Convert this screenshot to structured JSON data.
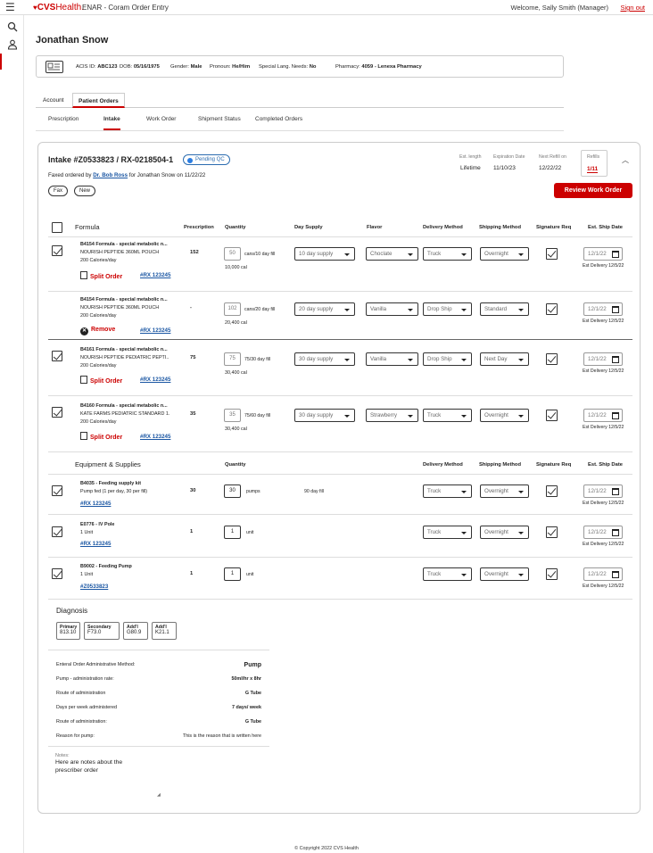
{
  "header": {
    "brand_bold": "CVS",
    "brand_light": "Health.",
    "app_title": "ENAR - Coram Order Entry",
    "welcome": "Welcome, Sally Smith (Manager)",
    "signout": "Sign out"
  },
  "patient": {
    "name": "Jonathan Snow",
    "acis_label": "ACIS ID:",
    "acis": "ABC123",
    "dob_label": "DOB:",
    "dob": "05/16/1975",
    "gender_label": "Gender:",
    "gender": "Male",
    "pronoun_label": "Pronoun:",
    "pronoun": "He/Him",
    "lang_label": "Special Lang. Needs:",
    "lang": "No",
    "pharm_label": "Pharmacy:",
    "pharm": "4059 - Lenexa Pharmacy"
  },
  "tabs": [
    "Account",
    "Patient Orders"
  ],
  "subtabs": [
    "Prescription",
    "Intake",
    "Work Order",
    "Shipment Status",
    "Completed Orders"
  ],
  "intake": {
    "title": "Intake #Z0533823 / RX-0218504-1",
    "status": "Pending QC",
    "faxed_pre": "Faxed ordered by ",
    "faxed_doc": "Dr. Bob Ross",
    "faxed_post": " for Jonathan Snow on 11/22/22",
    "pills": [
      "Fax",
      "New"
    ],
    "meta_labels": [
      "Est. length",
      "Expiration Date",
      "Next Refill on"
    ],
    "meta_values": [
      "Lifetime",
      "11/10/23",
      "12/22/22"
    ],
    "refills_label": "Refills",
    "refills": "1/11",
    "review_btn": "Review Work Order"
  },
  "formula_headers": {
    "formula": "Formula",
    "prescription": "Prescription",
    "quantity": "Quantity",
    "day_supply": "Day Supply",
    "flavor": "Flavor",
    "delivery": "Delivery Method",
    "shipping": "Shipping Method",
    "sig": "Signature Req",
    "ship": "Est. Ship Date"
  },
  "formulas": [
    {
      "name": "B4154 Formula - special metabolic n...",
      "sub1": "NOURISH PEPTIDE 360ML POUCH",
      "sub2": "200 Calories/day",
      "action": "Split Order",
      "rx": "#RX 123245",
      "presc": "152",
      "qty": "50",
      "unit": "cans/10 day fill",
      "cal": "10,000 cal",
      "supply": "10 day supply",
      "flavor": "Choclate",
      "delivery": "Truck",
      "shipping": "Overnight",
      "date": "12/1/22",
      "est": "Est Delivery 12/5/22"
    },
    {
      "name": "B4154 Formula - special metabolic n...",
      "sub1": "NOURISH PEPTIDE 360ML POUCH",
      "sub2": "200 Calories/day",
      "action": "Remove",
      "rx": "#RX 123245",
      "presc": "-",
      "qty": "102",
      "unit": "cans/20 day fill",
      "cal": "20,400 cal",
      "supply": "20 day supply",
      "flavor": "Vanilla",
      "delivery": "Drop Ship",
      "shipping": "Standard",
      "date": "12/1/22",
      "est": "Est Delivery 12/5/22"
    },
    {
      "name": "B4161 Formula - special metabolic n...",
      "sub1": "NOURISH PEPTIDE PEDIATRIC PEPTI..",
      "sub2": "200 Calories/day",
      "action": "Split Order",
      "rx": "#RX 123245",
      "presc": "75",
      "qty": "75",
      "unit": "75/30 day fill",
      "cal": "30,400 cal",
      "supply": "30 day supply",
      "flavor": "Vanilla",
      "delivery": "Drop Ship",
      "shipping": "Next Day",
      "date": "12/1/22",
      "est": "Est Delivery 12/5/22"
    },
    {
      "name": "B4160 Formula - special metabolic n...",
      "sub1": "KATE FARMS PEDIATRIC STANDARD 1.",
      "sub2": "200 Calories/day",
      "action": "Split Order",
      "rx": "#RX 123245",
      "presc": "35",
      "qty": "35",
      "unit": "75/60 day fill",
      "cal": "30,400 cal",
      "supply": "30 day supply",
      "flavor": "Strawberry",
      "delivery": "Truck",
      "shipping": "Overnight",
      "date": "12/1/22",
      "est": "Est Delivery 12/5/22"
    }
  ],
  "equip_headers": {
    "title": "Equipment & Supplies",
    "quantity": "Quantity",
    "delivery": "Delivery Method",
    "shipping": "Shipping Method",
    "sig": "Signature Req",
    "ship": "Est. Ship Date"
  },
  "equipment": [
    {
      "name": "B4035 - Feeding supply kit",
      "sub": "Pump fed (1 per day, 30 per fill)",
      "rx": "#RX 123245",
      "presc": "30",
      "qty": "30",
      "unit": "pumps",
      "fill": "90 day fill",
      "delivery": "Truck",
      "shipping": "Overnight",
      "date": "12/1/22",
      "est": "Est Delivery 12/5/22"
    },
    {
      "name": "E0776 - IV Pole",
      "sub": "1 Unit",
      "rx": "#RX 123245",
      "presc": "1",
      "qty": "1",
      "unit": "unit",
      "fill": "",
      "delivery": "Truck",
      "shipping": "Overnight",
      "date": "12/1/22",
      "est": "Est Delivery 12/5/22"
    },
    {
      "name": "B9002 - Feeding Pump",
      "sub": "1 Unit",
      "rx": "#Z0533823",
      "presc": "1",
      "qty": "1",
      "unit": "unit",
      "fill": "",
      "delivery": "Truck",
      "shipping": "Overnight",
      "date": "12/1/22",
      "est": "Est Delivery 12/5/22"
    }
  ],
  "diagnosis": {
    "title": "Diagnosis",
    "codes": [
      {
        "label": "Primary",
        "code": "813.10"
      },
      {
        "label": "Secondary",
        "code": "F73.0"
      },
      {
        "label": "Add'l",
        "code": "G80.9"
      },
      {
        "label": "Add'l",
        "code": "K21.1"
      }
    ]
  },
  "admin": [
    {
      "label": "Enteral Order Administrative Method:",
      "value": "Pump"
    },
    {
      "label": "Pump - administration rate:",
      "value": "50ml/hr x 8hr"
    },
    {
      "label": "Route of administration",
      "value": "G Tube"
    },
    {
      "label": "Days per week administered",
      "value": "7 days/ week"
    },
    {
      "label": "Route of administration:",
      "value": "G Tube"
    },
    {
      "label": "Reason for pump:",
      "value": "This is the reason that is written here"
    }
  ],
  "notes": {
    "label": "Notes:",
    "text": "Here are notes about the prescriber order"
  },
  "footer": "© Copyright 2022 CVS Health"
}
